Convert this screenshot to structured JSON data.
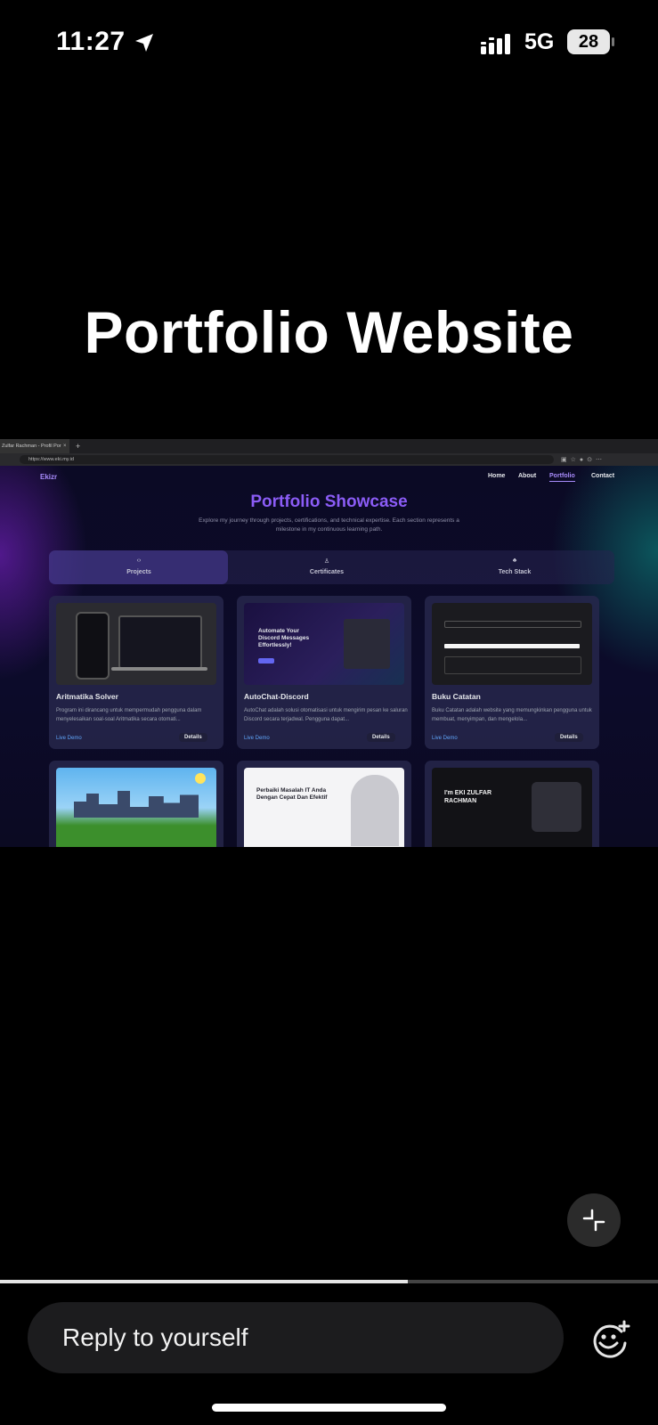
{
  "status_bar": {
    "time": "11:27",
    "network": "5G",
    "battery": "28"
  },
  "story": {
    "title": "Portfolio Website"
  },
  "browser": {
    "tab_title": "Zulfar Rachman - Profil Por",
    "tab_close": "×",
    "tab_new": "+",
    "url": "https://www.eki.my.id",
    "site": {
      "logo": "Ekizr",
      "nav": [
        "Home",
        "About",
        "Portfolio",
        "Contact"
      ],
      "title": "Portfolio Showcase",
      "subtitle": "Explore my journey through projects, certifications, and technical expertise. Each section represents a milestone in my continuous learning path.",
      "tabs": [
        {
          "icon": "‹›",
          "label": "Projects"
        },
        {
          "icon": "♙",
          "label": "Certificates"
        },
        {
          "icon": "♣",
          "label": "Tech Stack"
        }
      ],
      "projects": [
        {
          "title": "Aritmatika Solver",
          "desc": "Program ini dirancang untuk mempermudah pengguna dalam menyelesaikan soal-soal Aritmatika secara otomati...",
          "link": "Live Demo",
          "button": "Details"
        },
        {
          "title": "AutoChat-Discord",
          "desc": "AutoChat adalah solusi otomatisasi untuk mengirim pesan ke saluran Discord secara terjadwal. Pengguna dapat...",
          "link": "Live Demo",
          "button": "Details",
          "thumb_text": "Automate Your Discord Messages Effortlessly!"
        },
        {
          "title": "Buku Catatan",
          "desc": "Buku Catatan adalah website yang memungkinkan pengguna untuk membuat, menyimpan, dan mengelola...",
          "link": "Live Demo",
          "button": "Details"
        }
      ],
      "more_thumbs": [
        {
          "text": ""
        },
        {
          "text": "Perbaiki Masalah IT Anda Dengan Cepat Dan Efektif"
        },
        {
          "text": "I'm EKI ZULFAR RACHMAN"
        }
      ]
    }
  },
  "story_progress": 0.62,
  "reply": {
    "placeholder": "Reply to yourself"
  }
}
